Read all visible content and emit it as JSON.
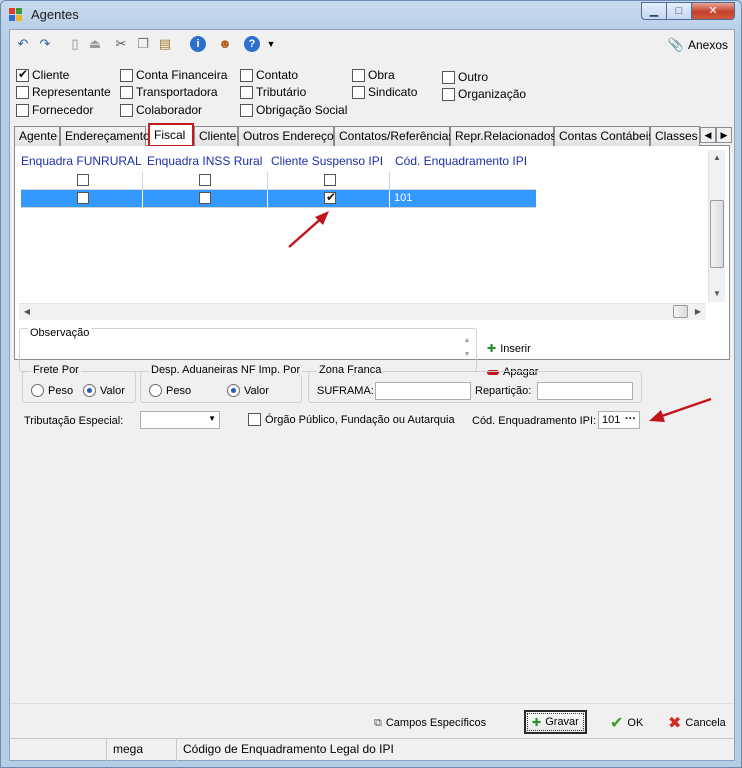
{
  "window": {
    "title": "Agentes"
  },
  "toolbar": {
    "anexos_label": "Anexos",
    "icons": [
      "undo-icon",
      "redo-icon",
      "new-document-icon",
      "eject-icon",
      "cut-icon",
      "copy-icon",
      "paste-icon",
      "info-icon",
      "user-icon",
      "help-icon",
      "dropdown-arrow-icon"
    ]
  },
  "agent_types": [
    {
      "label": "Cliente",
      "checked": true
    },
    {
      "label": "Representante",
      "checked": false
    },
    {
      "label": "Fornecedor",
      "checked": false
    },
    {
      "label": "Conta Financeira",
      "checked": false
    },
    {
      "label": "Transportadora",
      "checked": false
    },
    {
      "label": "Colaborador",
      "checked": false
    },
    {
      "label": "Contato",
      "checked": false
    },
    {
      "label": "Tributário",
      "checked": false
    },
    {
      "label": "Obrigação Social",
      "checked": false
    },
    {
      "label": "Obra",
      "checked": false
    },
    {
      "label": "Sindicato",
      "checked": false
    },
    {
      "label": "Outro",
      "checked": false
    },
    {
      "label": "Organização",
      "checked": false
    }
  ],
  "tabs": [
    "Agente",
    "Endereçamento",
    "Fiscal",
    "Cliente",
    "Outros Endereços",
    "Contatos/Referências",
    "Repr.Relacionados",
    "Contas Contábeis",
    "Classes"
  ],
  "active_tab": "Fiscal",
  "grid": {
    "columns": [
      "Enquadra FUNRURAL",
      "Enquadra INSS Rural",
      "Cliente Suspenso IPI",
      "Cód. Enquadramento IPI"
    ],
    "rows": [
      {
        "funrural": false,
        "inss": false,
        "suspenso": false,
        "cod": ""
      },
      {
        "funrural": false,
        "inss": false,
        "suspenso": true,
        "cod": "101"
      }
    ]
  },
  "observacao": {
    "label": "Observação",
    "value": ""
  },
  "actions": {
    "inserir": "Inserir",
    "apagar": "Apagar"
  },
  "frete": {
    "legend": "Frete Por",
    "options": [
      "Peso",
      "Valor"
    ],
    "selected": "Valor"
  },
  "desp": {
    "legend": "Desp. Aduaneiras NF Imp. Por",
    "options": [
      "Peso",
      "Valor"
    ],
    "selected": "Valor"
  },
  "zona": {
    "legend": "Zona Franca",
    "suframa_label": "SUFRAMA:",
    "suframa_value": "",
    "reparticao_label": "Repartição:",
    "reparticao_value": ""
  },
  "tributacao": {
    "label": "Tributação Especial:",
    "value": ""
  },
  "orgao_publico": {
    "label": "Órgão Público, Fundação ou Autarquia",
    "checked": false
  },
  "cod_enq": {
    "label": "Cód. Enquadramento IPI:",
    "value": "101",
    "ellipsis": "···"
  },
  "buttons": {
    "campos": "Campos Específicos",
    "gravar": "Gravar",
    "ok": "OK",
    "cancela": "Cancela"
  },
  "status": {
    "user": "mega",
    "hint": "Código de Enquadramento Legal do IPI"
  },
  "colors": {
    "selection": "#3399ff",
    "header_text": "#1d2ea8",
    "tab_highlight": "#c21d1d",
    "annotation_arrow": "#c0161b"
  }
}
